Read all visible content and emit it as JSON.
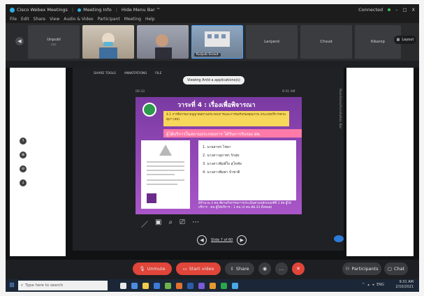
{
  "titlebar": {
    "app_title": "Cisco Webex Meetings",
    "meeting_info": "Meeting Info",
    "hide_menu": "Hide Menu Bar ^",
    "status": "Connected",
    "win_min": "–",
    "win_max": "□",
    "win_close": "X"
  },
  "menubar": [
    "File",
    "Edit",
    "Share",
    "View",
    "Audio & Video",
    "Participant",
    "Meeting",
    "Help"
  ],
  "participants": [
    {
      "name": "Unpubl",
      "sub": "ccc",
      "type": "avatar"
    },
    {
      "name": "",
      "type": "video1"
    },
    {
      "name": "",
      "type": "video2"
    },
    {
      "name": "Kurpub Sivaut",
      "type": "video3"
    },
    {
      "name": "Lanjand",
      "type": "avatar"
    },
    {
      "name": "Chsud",
      "type": "avatar"
    },
    {
      "name": "Kikanip",
      "type": "avatar"
    }
  ],
  "layout_button": "Layout",
  "share_toolbar": {
    "items": [
      "SHARE TOOLS",
      "ANNOTATIONS",
      "FILE"
    ],
    "tooltip": "Viewing Antd a applications(s)",
    "time_left": "00:33",
    "time_right": "9:31 AM",
    "vertical_label": "Reactions/Annotation Bar"
  },
  "slide": {
    "title": "วาระที่ 4 : เรื่องเพื่อพิจารณา",
    "subtitle": "4.1 การพิจารณาอนุญาตสถานประกอบการและการขอรับรองคุณภาพ ประเภทบริการควบคุมฯ (สพ)",
    "pink_bar": "ผู้ได้บริการในสถานประกอบการ ได้รับการรับรอง สพ.",
    "list": [
      "1. นายสาทร ไชยา",
      "2. นางสาวสุภาพร รักสุข",
      "3. นางสาวพิมพ์ใจ สุโขทัย",
      "4. นางสาวพิมพา บัวชาติ"
    ],
    "footer": "มีจำนวน 4 คน ที่ผ่านกิจกรรมการประเมินตามหลักเกณฑ์ที่ 3 จัด ผู้ได้บริการ : คน ผู้ได้บริการ : 1 คน (4 คน 88.33 ทั้งหมด)"
  },
  "slide_nav": {
    "label": "Slide 7 of 60",
    "prev": "◀",
    "next": "▶"
  },
  "left_tools": [
    "↑",
    "⊕",
    "⊖",
    "↓"
  ],
  "controls": {
    "unmute": "Unmute",
    "start_video": "Start video",
    "share": "Share",
    "participants": "Participants",
    "chat": "Chat",
    "more": "...",
    "end": "✕"
  },
  "taskbar": {
    "search_placeholder": "Type here to search",
    "time": "9:31 AM",
    "date": "2/10/2021",
    "lang": "ENG"
  },
  "colors": {
    "accent_blue": "#2bb0e6",
    "end_red": "#e0453a",
    "slide_purple": "#7a3aa2",
    "slide_yellow": "#f7d85a",
    "slide_pink": "#ff7aa8"
  }
}
